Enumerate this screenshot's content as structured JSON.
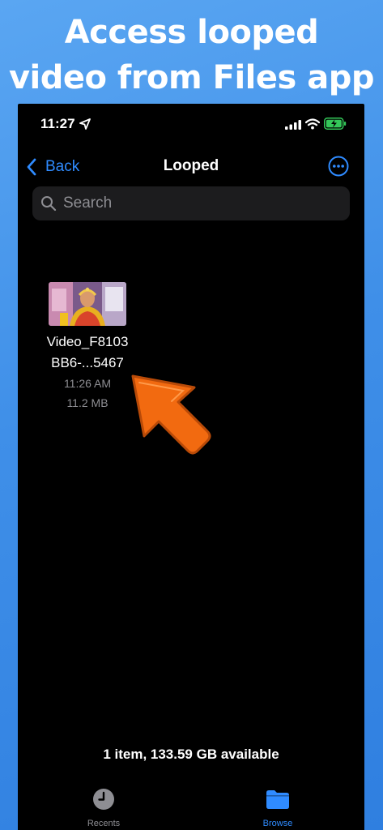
{
  "headline": {
    "line1": "Access looped",
    "line2": "video from Files app"
  },
  "status_bar": {
    "time": "11:27"
  },
  "nav": {
    "back_label": "Back",
    "title": "Looped"
  },
  "search": {
    "placeholder": "Search"
  },
  "file": {
    "name_line1": "Video_F8103",
    "name_line2": "BB6-...5467",
    "time": "11:26 AM",
    "size": "11.2 MB"
  },
  "storage_info": "1 item, 133.59 GB available",
  "tabs": [
    {
      "label": "Recents",
      "icon": "clock-icon",
      "active": false
    },
    {
      "label": "Browse",
      "icon": "folder-icon",
      "active": true
    }
  ],
  "colors": {
    "accent": "#2f8bff",
    "background": "#000000",
    "arrow": "#f26a10",
    "battery": "#34c759",
    "banner": "#4a9af0"
  }
}
